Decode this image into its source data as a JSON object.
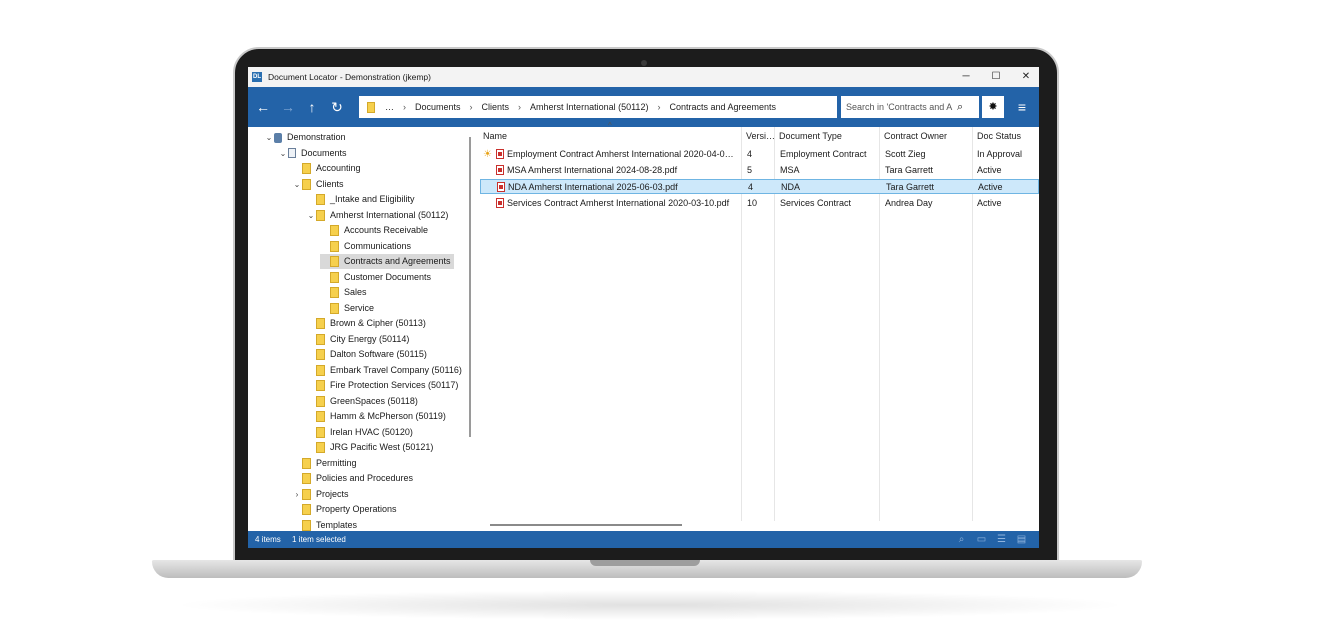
{
  "window": {
    "title": "Document Locator - Demonstration (jkemp)",
    "app_icon": "DL",
    "minimize": "─",
    "maximize": "☐",
    "close": "✕"
  },
  "toolbar": {
    "back_icon": "←",
    "forward_icon": "→",
    "up_icon": "↑",
    "refresh_icon": "↻",
    "breadcrumb": {
      "ellipsis": "…",
      "items": [
        "Documents",
        "Clients",
        "Amherst International (50112)",
        "Contracts and Agreements"
      ],
      "separator": "›"
    },
    "search_placeholder": "Search in 'Contracts and A",
    "search_icon": "⌕",
    "gear_icon": "✸",
    "menu_icon": "≡"
  },
  "tree": {
    "items": [
      {
        "label": "Demonstration",
        "chev": "⌄",
        "icon": "database"
      },
      {
        "label": "Documents",
        "chev": "⌄",
        "icon": "document"
      },
      {
        "label": "Accounting",
        "chev": "",
        "icon": "folder"
      },
      {
        "label": "Clients",
        "chev": "⌄",
        "icon": "folder"
      },
      {
        "label": "_Intake and Eligibility",
        "chev": "",
        "icon": "folder"
      },
      {
        "label": "Amherst International (50112)",
        "chev": "⌄",
        "icon": "folder"
      },
      {
        "label": "Accounts Receivable",
        "chev": "",
        "icon": "folder"
      },
      {
        "label": "Communications",
        "chev": "",
        "icon": "folder"
      },
      {
        "label": "Contracts and Agreements",
        "chev": "",
        "icon": "folder",
        "selected": true
      },
      {
        "label": "Customer Documents",
        "chev": "",
        "icon": "folder"
      },
      {
        "label": "Sales",
        "chev": "",
        "icon": "folder"
      },
      {
        "label": "Service",
        "chev": "",
        "icon": "folder"
      },
      {
        "label": "Brown & Cipher (50113)",
        "chev": "",
        "icon": "folder"
      },
      {
        "label": "City Energy (50114)",
        "chev": "",
        "icon": "folder"
      },
      {
        "label": "Dalton Software (50115)",
        "chev": "",
        "icon": "folder"
      },
      {
        "label": "Embark Travel Company (50116)",
        "chev": "",
        "icon": "folder"
      },
      {
        "label": "Fire Protection Services (50117)",
        "chev": "",
        "icon": "folder"
      },
      {
        "label": "GreenSpaces (50118)",
        "chev": "",
        "icon": "folder"
      },
      {
        "label": "Hamm & McPherson (50119)",
        "chev": "",
        "icon": "folder"
      },
      {
        "label": "Irelan HVAC (50120)",
        "chev": "",
        "icon": "folder"
      },
      {
        "label": "JRG Pacific West (50121)",
        "chev": "",
        "icon": "folder"
      },
      {
        "label": "Permitting",
        "chev": "",
        "icon": "folder"
      },
      {
        "label": "Policies and Procedures",
        "chev": "",
        "icon": "folder"
      },
      {
        "label": "Projects",
        "chev": "›",
        "icon": "folder"
      },
      {
        "label": "Property Operations",
        "chev": "",
        "icon": "folder"
      },
      {
        "label": "Templates",
        "chev": "",
        "icon": "folder"
      }
    ]
  },
  "list": {
    "sort_caret": "^",
    "columns": [
      "Name",
      "Versi…",
      "Document Type",
      "Contract Owner",
      "Doc Status"
    ],
    "rows": [
      {
        "name": "Employment Contract Amherst International 2020-04-0…",
        "version": "4",
        "type": "Employment Contract",
        "owner": "Scott Zieg",
        "status": "In Approval",
        "flag": "☀"
      },
      {
        "name": "MSA Amherst International 2024-08-28.pdf",
        "version": "5",
        "type": "MSA",
        "owner": "Tara Garrett",
        "status": "Active",
        "flag": ""
      },
      {
        "name": "NDA Amherst International 2025-06-03.pdf",
        "version": "4",
        "type": "NDA",
        "owner": "Tara Garrett",
        "status": "Active",
        "flag": "",
        "selected": true
      },
      {
        "name": "Services Contract Amherst International 2020-03-10.pdf",
        "version": "10",
        "type": "Services Contract",
        "owner": "Andrea Day",
        "status": "Active",
        "flag": ""
      }
    ]
  },
  "status": {
    "items": "4 items",
    "selected": "1 item selected",
    "icons": [
      "⌕",
      "▭",
      "☰",
      "▤"
    ]
  },
  "colors": {
    "accent": "#2363a8",
    "selection": "#cde8fa",
    "folder": "#f6d04d"
  }
}
